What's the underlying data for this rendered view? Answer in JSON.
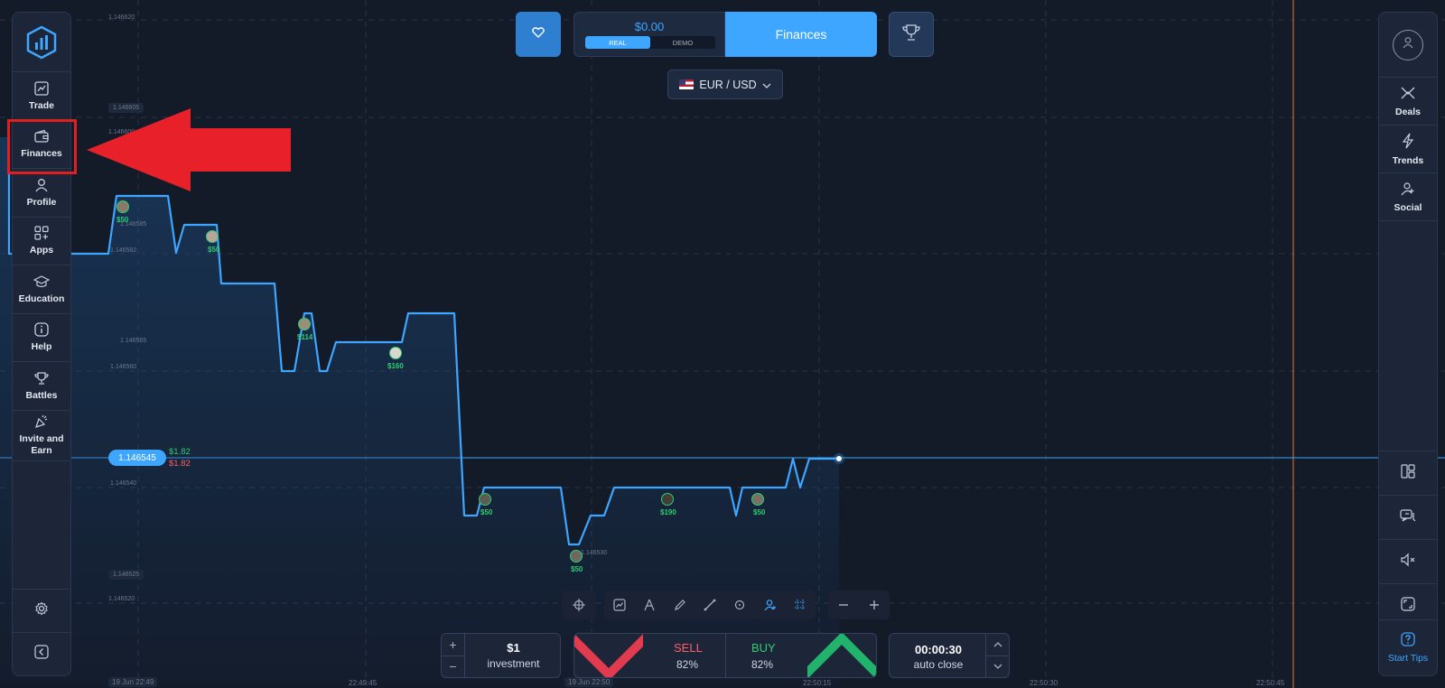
{
  "top": {
    "balance": "$0.00",
    "account_real": "REAL",
    "account_demo": "DEMO",
    "finances_button": "Finances",
    "pair": "EUR / USD"
  },
  "left_nav": {
    "items": [
      {
        "label": "Trade",
        "icon": "chart-icon"
      },
      {
        "label": "Finances",
        "icon": "wallet-icon"
      },
      {
        "label": "Profile",
        "icon": "user-icon"
      },
      {
        "label": "Apps",
        "icon": "apps-icon"
      },
      {
        "label": "Education",
        "icon": "graduation-cap-icon"
      },
      {
        "label": "Help",
        "icon": "info-icon"
      },
      {
        "label": "Battles",
        "icon": "trophy-icon"
      },
      {
        "label": "Invite and Earn",
        "icon": "party-icon"
      }
    ]
  },
  "right_nav": {
    "items": [
      {
        "label": "Deals",
        "icon": "deals-icon"
      },
      {
        "label": "Trends",
        "icon": "lightning-icon"
      },
      {
        "label": "Social",
        "icon": "add-user-icon"
      }
    ],
    "start_tips": "Start Tips"
  },
  "chart": {
    "current_price": "1.146545",
    "profit_up": "$1.82",
    "profit_down": "$1.82",
    "y_labels": [
      "1.146620",
      "1.146605",
      "1.146600",
      "1.146585",
      "1.146582",
      "1.146565",
      "1.146560",
      "1.146540",
      "1.146530",
      "1.146525",
      "1.146520"
    ],
    "x_labels": [
      "19 Jun 22:49",
      "22:49:45",
      "19 Jun 22:50",
      "22:50:15",
      "22:50:30",
      "22:50:45"
    ],
    "trades": [
      "$50",
      "$50",
      "$114",
      "$160",
      "$50",
      "$50",
      "$190",
      "$50"
    ]
  },
  "trade_panel": {
    "investment_value": "$1",
    "investment_label": "investment",
    "sell_label": "SELL",
    "sell_pct": "82%",
    "buy_label": "BUY",
    "buy_pct": "82%",
    "time_value": "00:00:30",
    "time_label": "auto close"
  },
  "colors": {
    "accent": "#3ea6ff",
    "sell": "#ff5d6a",
    "buy": "#2ecc71",
    "annotation": "#e02020"
  }
}
